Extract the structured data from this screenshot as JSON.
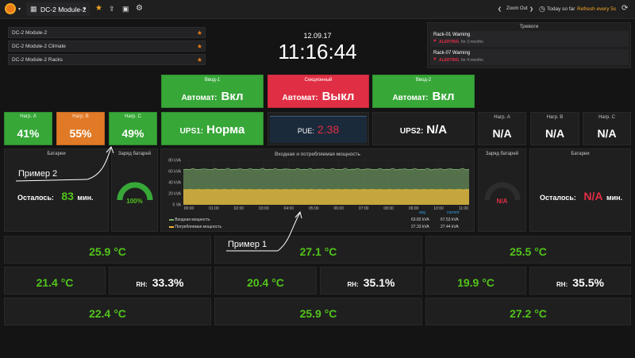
{
  "nav": {
    "dashboard_title": "DC-2 Module-2",
    "zoom_out": "Zoom Out",
    "time_range": "Today so far",
    "refresh": "Refresh every 5s"
  },
  "dashlist": [
    "DC-2 Module-2",
    "DC-2 Module-2 Climate",
    "DC-2 Module-2 Racks"
  ],
  "clock": {
    "date": "12.09.17",
    "time": "11:16:44"
  },
  "alerts": {
    "title": "Тревоги",
    "items": [
      {
        "name": "Rack-01 Warning",
        "state": "ALERTING",
        "duration": "for 3 months"
      },
      {
        "name": "Rack-07 Warning",
        "state": "ALERTING",
        "duration": "for 4 months"
      }
    ]
  },
  "inputs": {
    "vvod1": {
      "title": "Ввод-1",
      "label": "Автомат:",
      "value": "Вкл"
    },
    "section": {
      "title": "Секционный",
      "label": "Автомат:",
      "value": "Выкл"
    },
    "vvod2": {
      "title": "Ввод-2",
      "label": "Автомат:",
      "value": "Вкл"
    }
  },
  "loads_left": [
    {
      "title": "Нагр. A",
      "value": "41%"
    },
    {
      "title": "Нагр. B",
      "value": "55%"
    },
    {
      "title": "Нагр. C",
      "value": "49%"
    }
  ],
  "loads_right": [
    {
      "title": "Нагр. A",
      "value": "N/A"
    },
    {
      "title": "Нагр. B",
      "value": "N/A"
    },
    {
      "title": "Нагр. C",
      "value": "N/A"
    }
  ],
  "ups1": {
    "label": "UPS1:",
    "value": "Норма"
  },
  "pue": {
    "label": "PUE:",
    "value": "2.38"
  },
  "ups2": {
    "label": "UPS2:",
    "value": "N/A"
  },
  "battery_left": {
    "title": "Батареи",
    "label": "Осталось:",
    "value": "83",
    "unit": "мин."
  },
  "charge_left": {
    "title": "Заряд батарей",
    "value": "100%",
    "fraction": 1.0
  },
  "charge_right": {
    "title": "Заряд батарей",
    "value": "N/A"
  },
  "battery_right": {
    "title": "Батареи",
    "label": "Осталось:",
    "value": "N/A",
    "unit": "мин."
  },
  "annotations": {
    "example1": "Пример 1",
    "example2": "Пример 2"
  },
  "chart_data": {
    "type": "area",
    "title": "Входная и потребляемая мощность",
    "y_ticks": [
      "80 kVA",
      "60 kVA",
      "40 kVA",
      "20 kVA",
      "0 VA"
    ],
    "ylim": [
      0,
      80
    ],
    "x_ticks": [
      "00:00",
      "01:00",
      "02:00",
      "03:00",
      "04:00",
      "05:00",
      "06:00",
      "07:00",
      "08:00",
      "09:00",
      "10:00",
      "11:00"
    ],
    "legend_headers": {
      "avg": "avg",
      "current": "current"
    },
    "series": [
      {
        "name": "Входная мощность",
        "color": "#7eb26d",
        "avg": "63.82 kVA",
        "current": "67.53 kVA",
        "value": 64
      },
      {
        "name": "Потребляемая мощность",
        "color": "#eab839",
        "avg": "27.33 kVA",
        "current": "27.44 kVA",
        "value": 27.3
      }
    ]
  },
  "temps_row1": [
    "25.9 °C",
    "27.1 °C",
    "25.5 °C"
  ],
  "climate_row2": [
    {
      "temp": "21.4 °C",
      "rh_label": "RH:",
      "rh": "33.3%"
    },
    {
      "temp": "20.4 °C",
      "rh_label": "RH:",
      "rh": "35.1%"
    },
    {
      "temp": "19.9 °C",
      "rh_label": "RH:",
      "rh": "35.5%"
    }
  ],
  "temps_row3": [
    "22.4 °C",
    "25.9 °C",
    "27.2 °C"
  ],
  "colors": {
    "green": "#37a738",
    "red": "#e02f44",
    "orange": "#e07a27",
    "text_green": "#52c41a"
  }
}
